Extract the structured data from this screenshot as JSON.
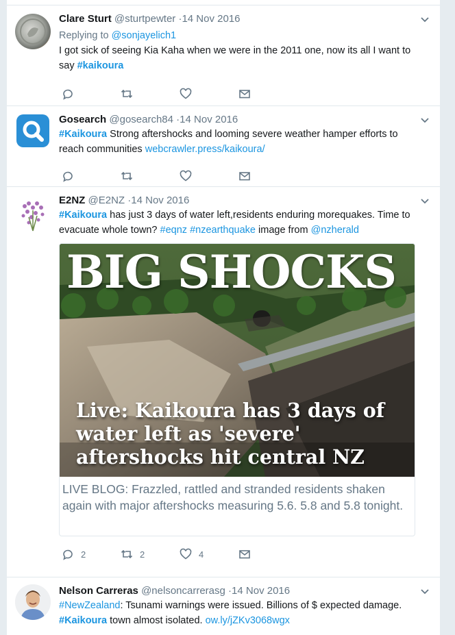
{
  "tweets": [
    {
      "name": "Clare Sturt",
      "handle": "@sturtpewter",
      "time": "·14 Nov 2016",
      "reply_prefix": "Replying to ",
      "reply_handle": "@sonjayelich1",
      "text_1": "I got sick of seeing Kia Kaha when we were in the 2011 one, now its all I want to",
      "text_2": "say ",
      "hashtag": "#kaikoura"
    },
    {
      "name": "Gosearch",
      "handle": "@gosearch84",
      "time": "·14 Nov 2016",
      "hashtag": "#Kaikoura",
      "text_1": " Strong aftershocks and looming severe weather hamper efforts to",
      "text_2": "reach communities  ",
      "link": "webcrawler.press/kaikoura/"
    },
    {
      "name": "E2NZ",
      "handle": "@E2NZ",
      "time": "·14 Nov 2016",
      "hashtag": "#Kaikoura",
      "text_1": " has just 3 days of water left,residents enduring morequakes. Time to",
      "text_2": "evacuate whole town? ",
      "tag_eqnz": "#eqnz",
      "tag_nzeq": "#nzearthquake",
      "text_3": " image from ",
      "mention": "@nzherald",
      "card": {
        "big_title": "BIG SHOCKS",
        "headline": "Live: Kaikoura has 3 days of water left as 'severe' aftershocks hit central NZ",
        "description": "LIVE BLOG: Frazzled, rattled and stranded residents shaken again with major aftershocks measuring 5.6. 5.8 and 5.8 tonight."
      },
      "reply_count": "2",
      "retweet_count": "2",
      "like_count": "4"
    },
    {
      "name": "Nelson Carreras",
      "handle": "@nelsoncarrerasg",
      "time": "·14 Nov 2016",
      "tag_nz": "#NewZealand",
      "text_1": ": Tsunami warnings were issued. Billions of $ expected damage.",
      "hashtag": "#Kaikoura",
      "text_2": " town almost isolated. ",
      "link": "ow.ly/jZKv3068wgx"
    }
  ],
  "colors": {
    "link": "#1b95e0",
    "muted": "#657786",
    "background": "#e6ecf0"
  },
  "icons": [
    "reply-icon",
    "retweet-icon",
    "like-icon",
    "message-icon",
    "chevron-down-icon"
  ]
}
